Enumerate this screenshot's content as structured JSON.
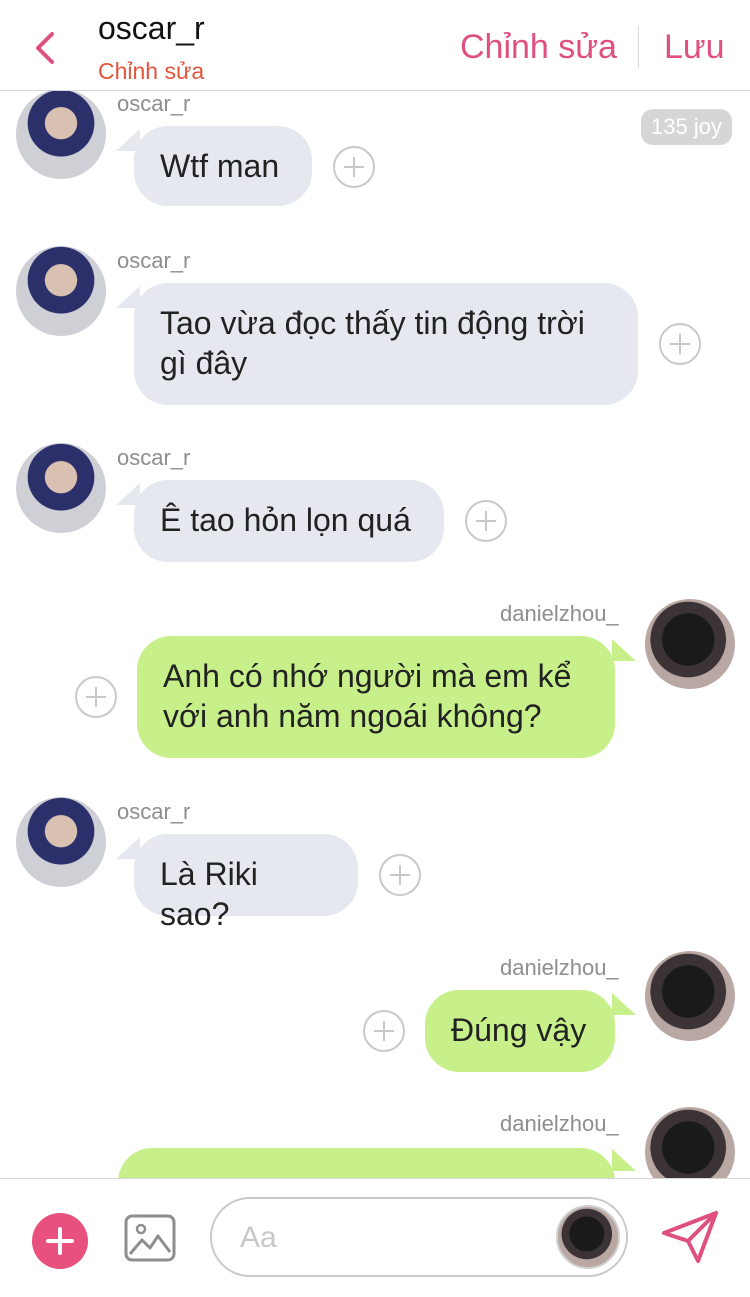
{
  "header": {
    "title": "oscar_r",
    "subtitle": "Chỉnh sửa",
    "edit_label": "Chỉnh sửa",
    "save_label": "Lưu"
  },
  "badge": {
    "text": "135 joy"
  },
  "messages": [
    {
      "sender": "oscar_r",
      "side": "left",
      "lines": [
        "Wtf man"
      ]
    },
    {
      "sender": "oscar_r",
      "side": "left",
      "lines": [
        "Tao vừa đọc thấy tin động trời",
        "gì đây"
      ]
    },
    {
      "sender": "oscar_r",
      "side": "left",
      "lines": [
        "Ê tao hỏn lọn quá"
      ]
    },
    {
      "sender": "danielzhou_",
      "side": "right",
      "lines": [
        "Anh có nhớ người mà em kể",
        "với anh năm ngoái không?"
      ]
    },
    {
      "sender": "oscar_r",
      "side": "left",
      "lines": [
        "Là Riki sao?"
      ]
    },
    {
      "sender": "danielzhou_",
      "side": "right",
      "lines": [
        "Đúng vậy"
      ]
    },
    {
      "sender": "danielzhou_",
      "side": "right",
      "lines": [
        ""
      ]
    }
  ],
  "composer": {
    "placeholder": "Aa"
  },
  "colors": {
    "accent": "#e0507f",
    "subtitle": "#e2553a",
    "bubble_left": "#e5e8ee",
    "bubble_right": "#c8f08a"
  },
  "icons": {
    "back": "chevron-left-icon",
    "add": "plus-circle-icon",
    "image": "image-icon",
    "send": "paper-plane-icon",
    "reaction": "plus-outline-icon"
  }
}
